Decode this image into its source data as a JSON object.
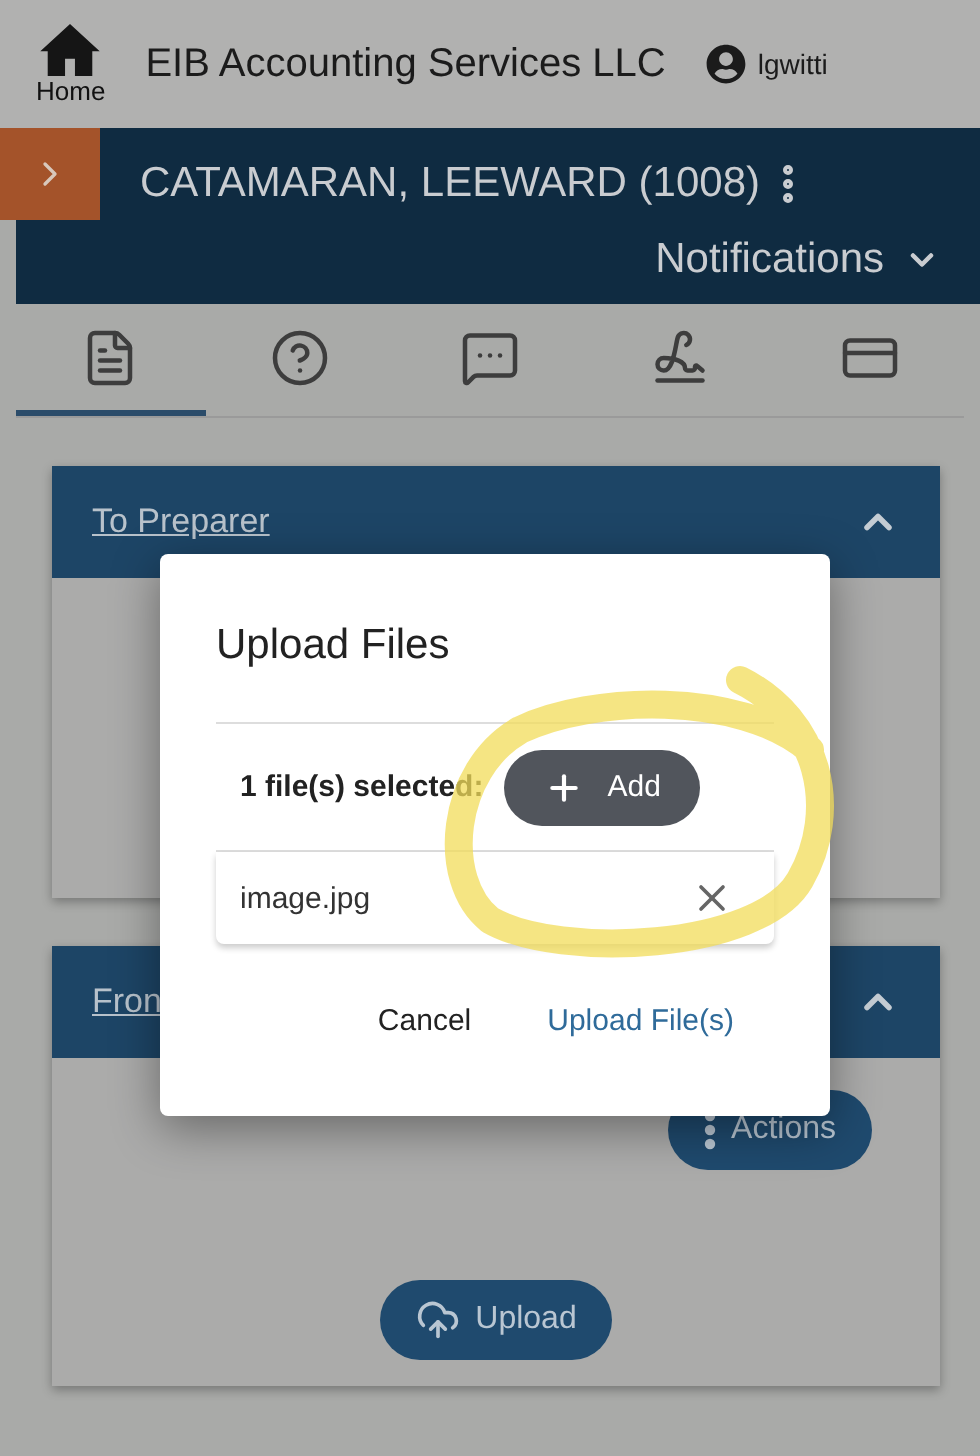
{
  "top_bar": {
    "home_label": "Home",
    "company": "EIB Accounting Services LLC",
    "user": "lgwitti"
  },
  "client_bar": {
    "name": "CATAMARAN, LEEWARD (1008)",
    "notifications": "Notifications"
  },
  "tabs": [
    {
      "kind": "document",
      "selected": true
    },
    {
      "kind": "help",
      "selected": false
    },
    {
      "kind": "chat",
      "selected": false
    },
    {
      "kind": "sign",
      "selected": false
    },
    {
      "kind": "card",
      "selected": false
    }
  ],
  "panels": [
    {
      "title": "To Preparer",
      "expanded": true
    },
    {
      "title": "Fron",
      "expanded": true,
      "actions": "Actions",
      "upload": "Upload"
    }
  ],
  "dialog": {
    "title": "Upload Files",
    "selected_count": "1 file(s) selected:",
    "add": "Add",
    "files": [
      "image.jpg"
    ],
    "cancel": "Cancel",
    "confirm": "Upload File(s)"
  }
}
